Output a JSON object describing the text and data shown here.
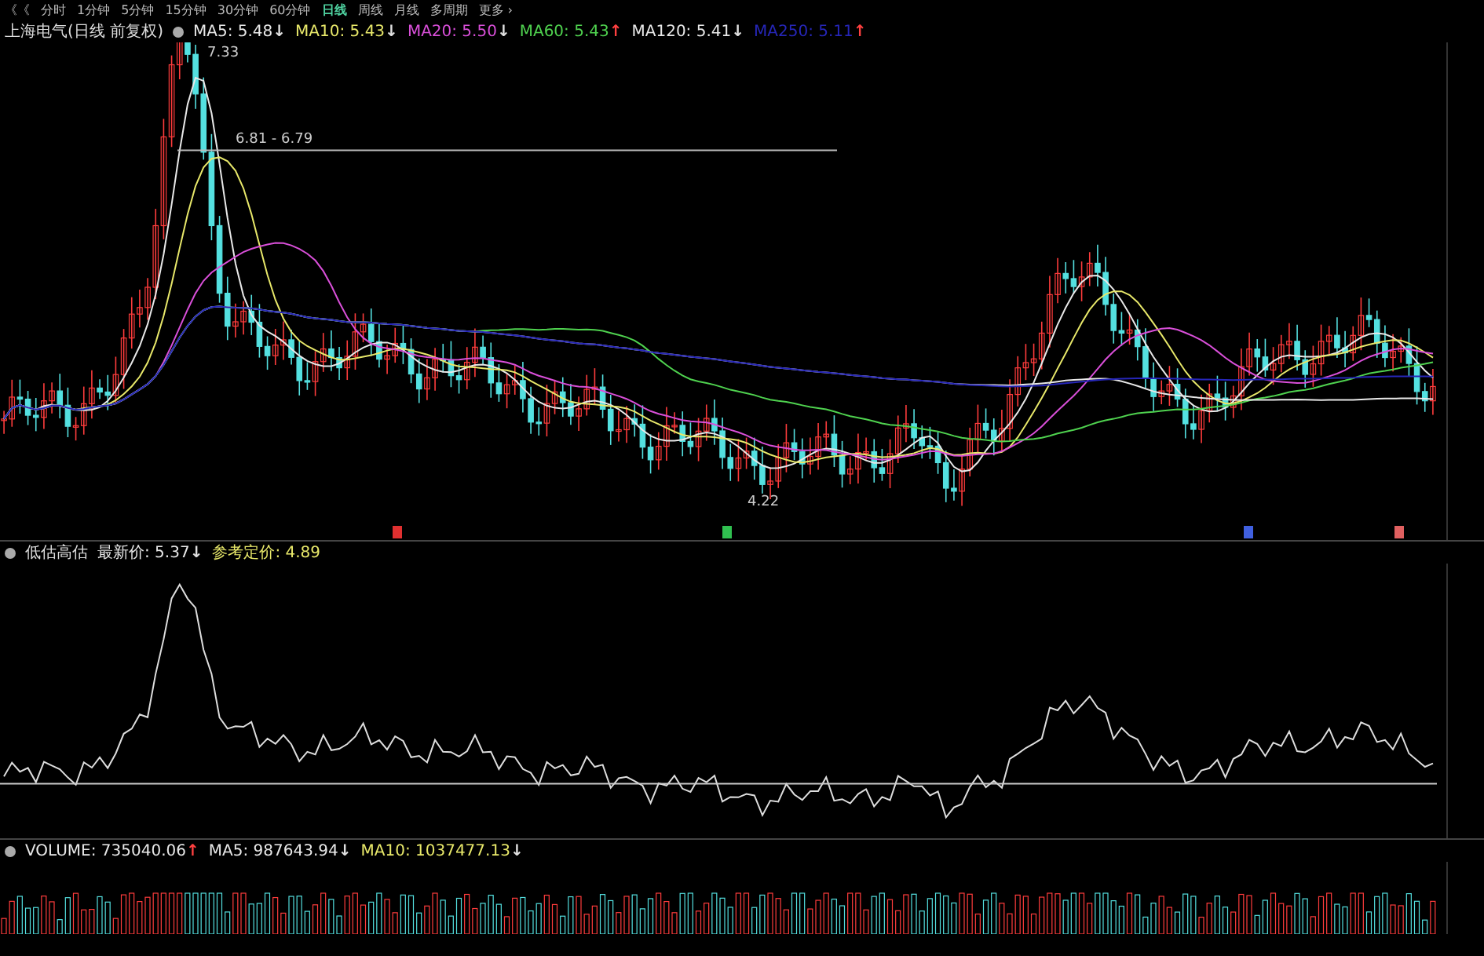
{
  "toolbar": {
    "back": "《《",
    "periods": [
      {
        "label": "分时",
        "selected": false
      },
      {
        "label": "1分钟",
        "selected": false
      },
      {
        "label": "5分钟",
        "selected": false
      },
      {
        "label": "15分钟",
        "selected": false
      },
      {
        "label": "30分钟",
        "selected": false
      },
      {
        "label": "60分钟",
        "selected": false
      },
      {
        "label": "日线",
        "selected": true
      },
      {
        "label": "周线",
        "selected": false
      },
      {
        "label": "月线",
        "selected": false
      },
      {
        "label": "多周期",
        "selected": false
      },
      {
        "label": "更多 ›",
        "selected": false
      }
    ]
  },
  "main_panel": {
    "title": "上海电气(日线 前复权)",
    "legend": [
      {
        "label": "MA5: 5.48",
        "arrow": "↓",
        "rising": false,
        "color": "#e8e8e8"
      },
      {
        "label": "MA10: 5.43",
        "arrow": "↓",
        "rising": false,
        "color": "#e8e86a"
      },
      {
        "label": "MA20: 5.50",
        "arrow": "↓",
        "rising": false,
        "color": "#d94fd9"
      },
      {
        "label": "MA60: 5.43",
        "arrow": "↑",
        "rising": true,
        "color": "#4fd24f"
      },
      {
        "label": "MA120: 5.41",
        "arrow": "↓",
        "rising": false,
        "color": "#e8e8e8"
      },
      {
        "label": "MA250: 5.11",
        "arrow": "↑",
        "rising": true,
        "color": "#2626b8"
      }
    ],
    "high_label": "7.33",
    "range_label": "6.81 - 6.79",
    "low_label": "4.22",
    "markers": [
      {
        "color": "#e03030"
      },
      {
        "color": "#30c050"
      },
      {
        "color": "#4060e0"
      },
      {
        "color": "#e06060"
      }
    ]
  },
  "indicator_panel": {
    "title": "低估高估",
    "legend": [
      {
        "label": "最新价: 5.37",
        "arrow": "↓",
        "rising": false,
        "color": "#e8e8e8"
      },
      {
        "label": "参考定价: 4.89",
        "color": "#e8e86a"
      }
    ]
  },
  "volume_panel": {
    "legend": [
      {
        "label": "VOLUME: 735040.06",
        "arrow": "↑",
        "rising": true,
        "color": "#e8e8e8"
      },
      {
        "label": "MA5: 987643.94",
        "arrow": "↓",
        "rising": false,
        "color": "#e8e8e8"
      },
      {
        "label": "MA10: 1037477.13",
        "arrow": "↓",
        "rising": false,
        "color": "#e8e86a"
      }
    ]
  }
}
